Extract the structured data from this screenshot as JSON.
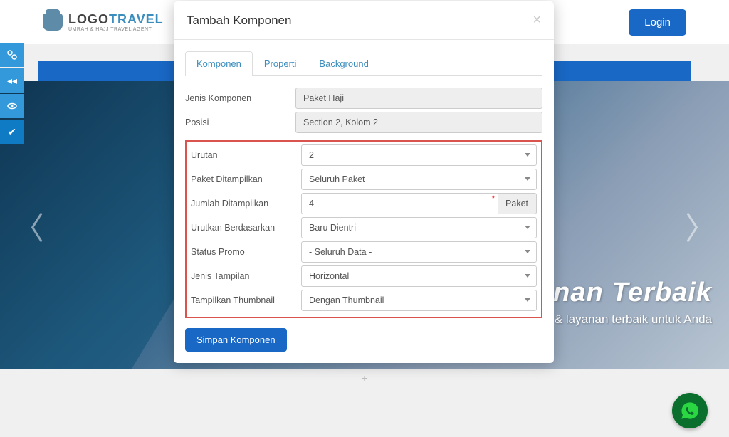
{
  "header": {
    "logo_bold": "LOGO",
    "logo_accent": "TRAVEL",
    "logo_sub": "UMRAH & HAJJ TRAVEL AGENT",
    "login": "Login"
  },
  "hero": {
    "title_part": "ayanan Terbaik",
    "subtitle": "Garansi harga & layanan terbaik untuk Anda"
  },
  "modal": {
    "title": "Tambah Komponen",
    "tabs": {
      "komponen": "Komponen",
      "properti": "Properti",
      "background": "Background"
    },
    "labels": {
      "jenis_komponen": "Jenis Komponen",
      "posisi": "Posisi",
      "urutan": "Urutan",
      "paket_ditampilkan": "Paket Ditampilkan",
      "jumlah_ditampilkan": "Jumlah Ditampilkan",
      "urutkan_berdasarkan": "Urutkan Berdasarkan",
      "status_promo": "Status Promo",
      "jenis_tampilan": "Jenis Tampilan",
      "tampilkan_thumbnail": "Tampilkan Thumbnail"
    },
    "values": {
      "jenis_komponen": "Paket Haji",
      "posisi": "Section 2, Kolom 2",
      "urutan": "2",
      "paket_ditampilkan": "Seluruh Paket",
      "jumlah_ditampilkan": "4",
      "jumlah_unit": "Paket",
      "urutkan_berdasarkan": "Baru Dientri",
      "status_promo": "- Seluruh Data -",
      "jenis_tampilan": "Horizontal",
      "tampilkan_thumbnail": "Dengan Thumbnail"
    },
    "submit": "Simpan Komponen"
  },
  "plus": "+"
}
